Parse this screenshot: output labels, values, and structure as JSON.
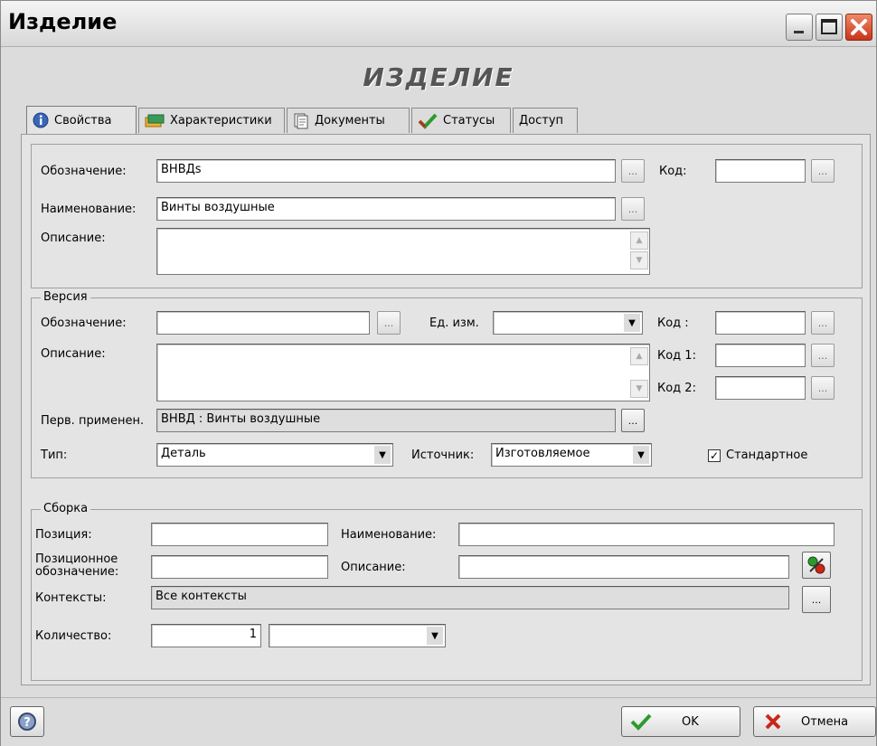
{
  "window": {
    "title": "Изделие",
    "heading": "ИЗДЕЛИЕ"
  },
  "tabs": [
    {
      "label": "Свойства",
      "icon": "info-icon"
    },
    {
      "label": "Характеристики",
      "icon": "characteristics-icon"
    },
    {
      "label": "Документы",
      "icon": "documents-icon"
    },
    {
      "label": "Статусы",
      "icon": "checkmark-icon"
    },
    {
      "label": "Доступ",
      "icon": ""
    }
  ],
  "item": {
    "designation_label": "Обозначение:",
    "designation_value": "ВНВДs",
    "code_label": "Код:",
    "code_value": "",
    "name_label": "Наименование:",
    "name_value": "Винты воздушные",
    "description_label": "Описание:",
    "description_value": ""
  },
  "version": {
    "group_label": "Версия",
    "designation_label": "Обозначение:",
    "designation_value": "",
    "unit_label": "Ед. изм.",
    "unit_value": "",
    "code_label": "Код :",
    "code1_label": "Код 1:",
    "code2_label": "Код 2:",
    "description_label": "Описание:",
    "description_value": "",
    "first_use_label": "Перв. применен.",
    "first_use_value": "ВНВД : Винты воздушные",
    "type_label": "Тип:",
    "type_value": "Деталь",
    "source_label": "Источник:",
    "source_value": "Изготовляемое",
    "standard_label": "Стандартное",
    "standard_checked": true
  },
  "assembly": {
    "group_label": "Сборка",
    "position_label": "Позиция:",
    "position_value": "",
    "name_label": "Наименование:",
    "name_value": "",
    "pos_designation_label_1": "Позиционное",
    "pos_designation_label_2": "обозначение:",
    "pos_designation_value": "",
    "description_label": "Описание:",
    "description_value": "",
    "contexts_label": "Контексты:",
    "contexts_value": "Все контексты",
    "quantity_label": "Количество:",
    "quantity_value": "1",
    "quantity_unit_value": ""
  },
  "buttons": {
    "ellipsis": "...",
    "ok": "OK",
    "cancel": "Отмена"
  },
  "colors": {
    "ok_check": "#2e9a2e",
    "cancel_x": "#c8281a",
    "close_button": "#d04020"
  }
}
